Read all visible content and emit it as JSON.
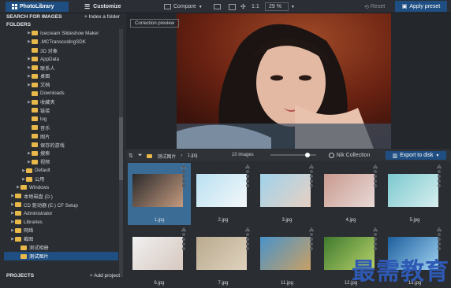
{
  "topbar": {
    "photolibrary_tab": "PhotoLibrary",
    "customize_tab": "Customize",
    "compare_label": "Compare",
    "zoom_ratio": "1:1",
    "zoom_percent": "29 %",
    "reset_label": "Reset",
    "apply_label": "Apply preset"
  },
  "sidebar": {
    "search_label": "SEARCH FOR IMAGES",
    "index_folder_label": "+ Index a folder",
    "folders_label": "FOLDERS",
    "projects_label": "PROJECTS",
    "add_project_label": "+ Add project",
    "tree": [
      {
        "label": "Icecream Slideshow Maker",
        "indent": 3,
        "arrow": true
      },
      {
        "label": ".MCTranscodingSDK",
        "indent": 3,
        "arrow": true
      },
      {
        "label": "3D 对象",
        "indent": 3,
        "arrow": false
      },
      {
        "label": "AppData",
        "indent": 3,
        "arrow": true
      },
      {
        "label": "联系人",
        "indent": 3,
        "arrow": true
      },
      {
        "label": "桌面",
        "indent": 3,
        "arrow": true
      },
      {
        "label": "文档",
        "indent": 3,
        "arrow": true
      },
      {
        "label": "Downloads",
        "indent": 3,
        "arrow": false
      },
      {
        "label": "收藏夹",
        "indent": 3,
        "arrow": true
      },
      {
        "label": "链接",
        "indent": 3,
        "arrow": false
      },
      {
        "label": "log",
        "indent": 3,
        "arrow": false
      },
      {
        "label": "音乐",
        "indent": 3,
        "arrow": false
      },
      {
        "label": "图片",
        "indent": 3,
        "arrow": false
      },
      {
        "label": "保存的游戏",
        "indent": 3,
        "arrow": false
      },
      {
        "label": "搜索",
        "indent": 3,
        "arrow": true
      },
      {
        "label": "视频",
        "indent": 3,
        "arrow": true
      },
      {
        "label": "Default",
        "indent": 2,
        "arrow": true
      },
      {
        "label": "公用",
        "indent": 2,
        "arrow": true
      },
      {
        "label": "Windows",
        "indent": 1,
        "arrow": true
      },
      {
        "label": "本地磁盘 (D:)",
        "indent": 0,
        "arrow": true
      },
      {
        "label": "CD 驱动器 (E:) CF Setup",
        "indent": 0,
        "arrow": true
      },
      {
        "label": "Administrator",
        "indent": 0,
        "arrow": true
      },
      {
        "label": "Libraries",
        "indent": 0,
        "arrow": true
      },
      {
        "label": "网络",
        "indent": 0,
        "arrow": true
      },
      {
        "label": "截图",
        "indent": 0,
        "arrow": true
      },
      {
        "label": "测试相册",
        "indent": 1,
        "arrow": false
      },
      {
        "label": "测试图片",
        "indent": 1,
        "arrow": false,
        "selected": true
      }
    ]
  },
  "preview": {
    "correction_label": "Correction preview"
  },
  "stripbar": {
    "folder_label": "测试图片",
    "file_label": "1.jpg",
    "image_count": "10 images",
    "nik_label": "Nik Collection",
    "export_label": "Export to disk"
  },
  "thumbnails": [
    {
      "name": "1.jpg",
      "selected": true,
      "colors": [
        "#2b2a2a",
        "#c49a7f"
      ]
    },
    {
      "name": "2.jpg",
      "colors": [
        "#b9e1f2",
        "#f4f7f9"
      ]
    },
    {
      "name": "3.jpg",
      "colors": [
        "#9fd3ec",
        "#e7d0c2"
      ]
    },
    {
      "name": "4.jpg",
      "colors": [
        "#c99a8e",
        "#e8d9d6"
      ]
    },
    {
      "name": "5.jpg",
      "colors": [
        "#7bc9cf",
        "#d7eeee"
      ]
    },
    {
      "name": "6.jpg",
      "colors": [
        "#f0f0f0",
        "#d7c8c0"
      ]
    },
    {
      "name": "7.jpg",
      "colors": [
        "#b9aa8f",
        "#dfd2bd"
      ]
    },
    {
      "name": "11.jpg",
      "colors": [
        "#4a93c9",
        "#c8a065"
      ]
    },
    {
      "name": "12.jpg",
      "colors": [
        "#3f7a2e",
        "#b8d26b"
      ]
    },
    {
      "name": "13.jpg",
      "colors": [
        "#1d5f9e",
        "#9fd2f0"
      ]
    }
  ],
  "watermark": "最需教育",
  "colors": {
    "accent": "#1f4f82",
    "selection": "#3a6c96",
    "folder": "#e8b94a"
  }
}
